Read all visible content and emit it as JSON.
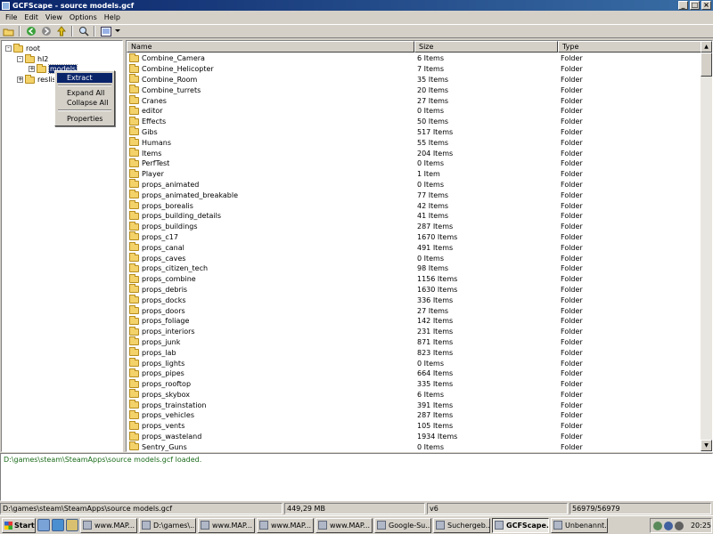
{
  "window": {
    "title": "GCFScape - source models.gcf",
    "controls": [
      "_",
      "□",
      "×"
    ]
  },
  "menu": [
    "File",
    "Edit",
    "View",
    "Options",
    "Help"
  ],
  "toolbar": [
    "open-folder-icon",
    "back-icon",
    "forward-icon",
    "up-icon",
    "search-icon",
    "view-options-icon"
  ],
  "tree": [
    {
      "label": "root",
      "expander": "-",
      "level": 0
    },
    {
      "label": "hl2",
      "expander": "-",
      "level": 1
    },
    {
      "label": "models",
      "expander": "+",
      "level": 2,
      "selected": true
    },
    {
      "label": "reslis",
      "expander": "+",
      "level": 1
    }
  ],
  "context_menu": {
    "items": [
      "Extract",
      "Expand All",
      "Collapse All",
      "Properties"
    ],
    "highlighted": "Extract"
  },
  "list": {
    "columns": [
      "Name",
      "Size",
      "Type"
    ],
    "rows": [
      [
        "Combine_Camera",
        "6 Items",
        "Folder"
      ],
      [
        "Combine_Helicopter",
        "7 Items",
        "Folder"
      ],
      [
        "Combine_Room",
        "35 Items",
        "Folder"
      ],
      [
        "Combine_turrets",
        "20 Items",
        "Folder"
      ],
      [
        "Cranes",
        "27 Items",
        "Folder"
      ],
      [
        "editor",
        "0 Items",
        "Folder"
      ],
      [
        "Effects",
        "50 Items",
        "Folder"
      ],
      [
        "Gibs",
        "517 Items",
        "Folder"
      ],
      [
        "Humans",
        "55 Items",
        "Folder"
      ],
      [
        "Items",
        "204 Items",
        "Folder"
      ],
      [
        "PerfTest",
        "0 Items",
        "Folder"
      ],
      [
        "Player",
        "1 Item",
        "Folder"
      ],
      [
        "props_animated",
        "0 Items",
        "Folder"
      ],
      [
        "props_animated_breakable",
        "77 Items",
        "Folder"
      ],
      [
        "props_borealis",
        "42 Items",
        "Folder"
      ],
      [
        "props_building_details",
        "41 Items",
        "Folder"
      ],
      [
        "props_buildings",
        "287 Items",
        "Folder"
      ],
      [
        "props_c17",
        "1670 Items",
        "Folder"
      ],
      [
        "props_canal",
        "491 Items",
        "Folder"
      ],
      [
        "props_caves",
        "0 Items",
        "Folder"
      ],
      [
        "props_citizen_tech",
        "98 Items",
        "Folder"
      ],
      [
        "props_combine",
        "1156 Items",
        "Folder"
      ],
      [
        "props_debris",
        "1630 Items",
        "Folder"
      ],
      [
        "props_docks",
        "336 Items",
        "Folder"
      ],
      [
        "props_doors",
        "27 Items",
        "Folder"
      ],
      [
        "props_foliage",
        "142 Items",
        "Folder"
      ],
      [
        "props_interiors",
        "231 Items",
        "Folder"
      ],
      [
        "props_junk",
        "871 Items",
        "Folder"
      ],
      [
        "props_lab",
        "823 Items",
        "Folder"
      ],
      [
        "props_lights",
        "0 Items",
        "Folder"
      ],
      [
        "props_pipes",
        "664 Items",
        "Folder"
      ],
      [
        "props_rooftop",
        "335 Items",
        "Folder"
      ],
      [
        "props_skybox",
        "6 Items",
        "Folder"
      ],
      [
        "props_trainstation",
        "391 Items",
        "Folder"
      ],
      [
        "props_vehicles",
        "287 Items",
        "Folder"
      ],
      [
        "props_vents",
        "105 Items",
        "Folder"
      ],
      [
        "props_wasteland",
        "1934 Items",
        "Folder"
      ],
      [
        "Sentry_Guns",
        "0 Items",
        "Folder"
      ]
    ]
  },
  "log": "D:\\games\\steam\\SteamApps\\source models.gcf loaded.",
  "status": {
    "path": "D:\\games\\steam\\SteamApps\\source models.gcf",
    "size": "449,29 MB",
    "version": "v6",
    "count": "56979/56979"
  },
  "taskbar": {
    "start": "Start",
    "buttons": [
      {
        "label": "www.MAP...",
        "active": false
      },
      {
        "label": "D:\\games\\...",
        "active": false
      },
      {
        "label": "www.MAP...",
        "active": false
      },
      {
        "label": "www.MAP...",
        "active": false
      },
      {
        "label": "www.MAP...",
        "active": false
      },
      {
        "label": "Google-Su...",
        "active": false
      },
      {
        "label": "Suchergeb...",
        "active": false
      },
      {
        "label": "GCFScape...",
        "active": true
      },
      {
        "label": "Unbenannt...",
        "active": false
      }
    ],
    "clock": "20:25"
  }
}
